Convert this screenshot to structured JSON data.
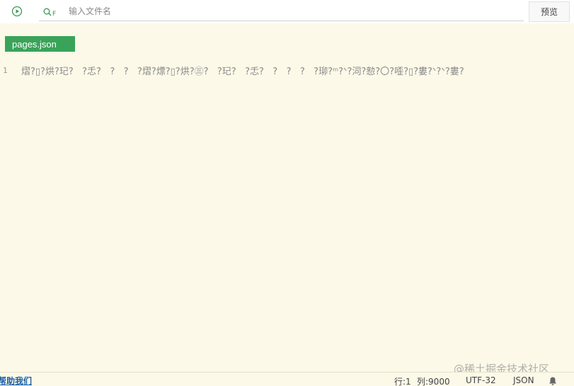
{
  "toolbar": {
    "run_icon": "play-circle-icon",
    "search_icon": "search-file-icon",
    "search_icon_letter": "F",
    "search_placeholder": "输入文件名",
    "preview_label": "预览"
  },
  "tabs": [
    {
      "label": "pages.json",
      "active": true
    }
  ],
  "editor": {
    "lines": [
      {
        "number": "1",
        "text": "熠?▯?烘?玘?   ?忎?   ?   ?   ?熠?熛?▯?烘?㊂?   ?玘?   ?忎?   ?   ?   ?   ?珋?ᵐ?ᐠ?泀?愸?〇?㗏?▯?婁?ᐠ?ᐠ?婁?"
      }
    ]
  },
  "status": {
    "help_label": "帮助我们",
    "row": "行:1",
    "col": "列:9000",
    "encoding": "UTF-32",
    "language": "JSON",
    "bell_icon": "bell-icon"
  },
  "watermark": "@稀土掘金技术社区",
  "colors": {
    "tab_active": "#3aa35a",
    "editor_bg": "#fcf9e8",
    "link": "#1a5fa8"
  }
}
